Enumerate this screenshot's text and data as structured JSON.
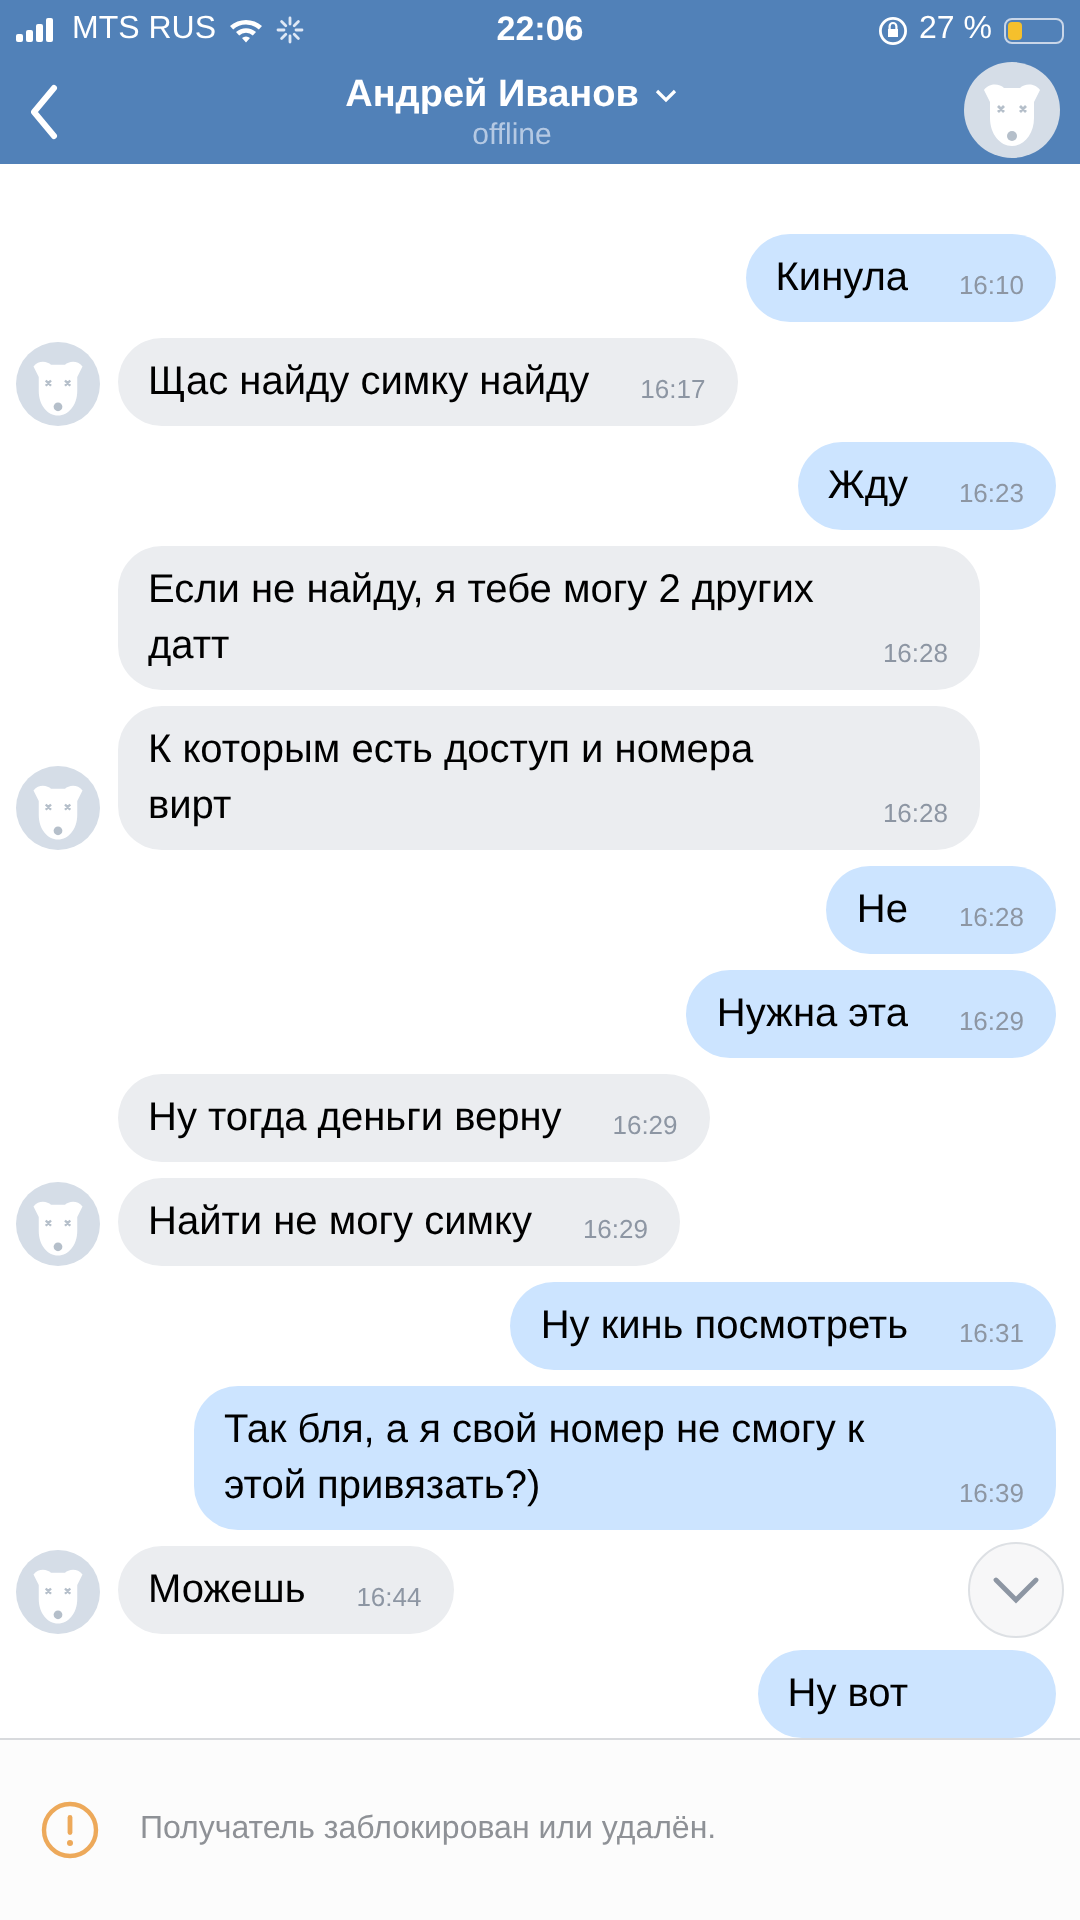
{
  "status_bar": {
    "carrier": "MTS RUS",
    "time": "22:06",
    "battery": "27 %"
  },
  "header": {
    "title": "Андрей Иванов",
    "subtitle": "offline"
  },
  "messages": [
    {
      "kind": "outgoing",
      "text": "Кинула",
      "time": "16:10"
    },
    {
      "kind": "incoming",
      "text": "Щас найду  симку найду",
      "time": "16:17",
      "avatar": true
    },
    {
      "kind": "outgoing",
      "text": "Жду",
      "time": "16:23"
    },
    {
      "kind": "incoming",
      "text": "Если не найду, я тебе могу 2 других датт",
      "time": "16:28",
      "avatar": false
    },
    {
      "kind": "incoming",
      "text": "К которым есть доступ и номера вирт",
      "time": "16:28",
      "avatar": true
    },
    {
      "kind": "outgoing",
      "text": "Не",
      "time": "16:28"
    },
    {
      "kind": "outgoing",
      "text": "Нужна эта",
      "time": "16:29"
    },
    {
      "kind": "incoming",
      "text": "Ну тогда деньги верну",
      "time": "16:29",
      "avatar": false
    },
    {
      "kind": "incoming",
      "text": "Найти не могу симку",
      "time": "16:29",
      "avatar": true
    },
    {
      "kind": "outgoing",
      "text": "Ну кинь посмотреть",
      "time": "16:31"
    },
    {
      "kind": "outgoing",
      "text": "Так бля, а я свой номер не смогу к этой привязать?)",
      "time": "16:39"
    },
    {
      "kind": "incoming",
      "text": "Можешь",
      "time": "16:44",
      "avatar": true
    },
    {
      "kind": "outgoing",
      "text": "Ну вот"
    }
  ],
  "footer": {
    "notice": "Получатель заблокирован или удалён."
  }
}
